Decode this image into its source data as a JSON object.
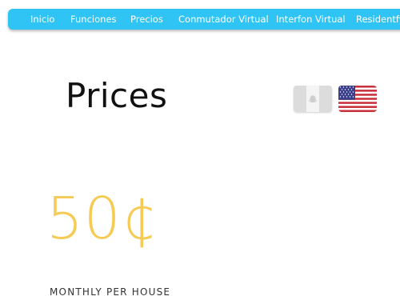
{
  "nav": {
    "items": [
      {
        "label": "Inicio"
      },
      {
        "label": "Funciones"
      },
      {
        "label": "Precios"
      },
      {
        "label": "Conmutador Virtual"
      },
      {
        "label": "Interfon Virtual"
      },
      {
        "label": "Residentfy"
      }
    ]
  },
  "page": {
    "title": "Prices",
    "price": "50¢",
    "price_caption": "MONTHLY PER HOUSE"
  },
  "languages": [
    {
      "name": "mexico-flag-icon",
      "active": false
    },
    {
      "name": "usa-flag-icon",
      "active": true
    }
  ],
  "colors": {
    "nav_background": "#2fc4f4",
    "nav_text": "#ffffff",
    "price": "#f6cb55",
    "title": "#111111"
  }
}
